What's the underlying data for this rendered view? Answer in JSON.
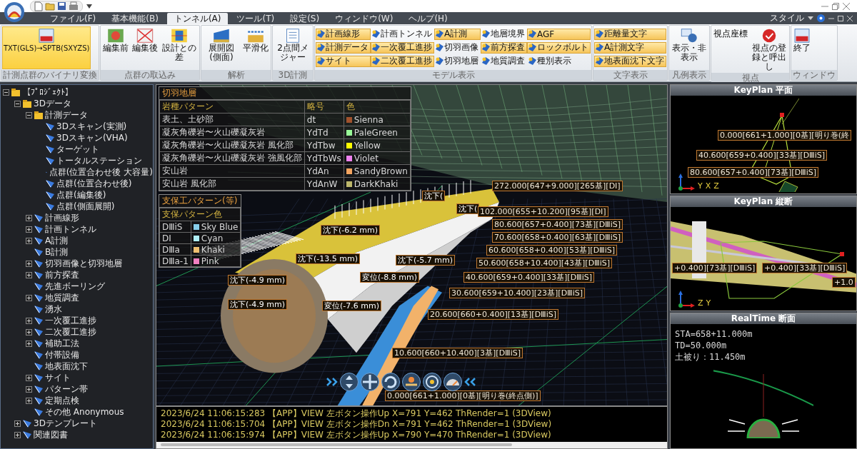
{
  "menu_tabs": [
    {
      "label": "ファイル(F)",
      "selected": false
    },
    {
      "label": "基本機能(B)",
      "selected": false
    },
    {
      "label": "トンネル(A)",
      "selected": true
    },
    {
      "label": "ツール(T)",
      "selected": false
    },
    {
      "label": "設定(S)",
      "selected": false
    },
    {
      "label": "ウィンドウ(W)",
      "selected": false
    },
    {
      "label": "ヘルプ(H)",
      "selected": false
    }
  ],
  "style_menu": "スタイル",
  "ribbon_groups": [
    {
      "label": "計測点群のバイナリ変換",
      "buttons": [
        {
          "kind": "large",
          "label": "TXT(GLS)→SPTB(SXYZS)",
          "on": true
        }
      ]
    },
    {
      "label": "点群の取込み",
      "buttons": [
        {
          "kind": "large",
          "label": "編集前",
          "on": false
        },
        {
          "kind": "large",
          "label": "編集後",
          "on": false
        },
        {
          "kind": "large",
          "label": "設計との差",
          "on": false
        }
      ]
    },
    {
      "label": "解析",
      "buttons": [
        {
          "kind": "large",
          "label": "展開図(側面)",
          "on": false
        },
        {
          "kind": "large",
          "label": "平滑化",
          "on": false
        }
      ]
    },
    {
      "label": "3D計測",
      "buttons": [
        {
          "kind": "large",
          "label": "2点間メジャー",
          "on": false
        }
      ]
    },
    {
      "label": "モデル表示",
      "buttons": [
        {
          "kind": "small",
          "label": "計画線形",
          "on": true
        },
        {
          "kind": "small",
          "label": "計測データ",
          "on": true
        },
        {
          "kind": "small",
          "label": "サイト",
          "on": true
        },
        {
          "kind": "small",
          "label": "計画トンネル",
          "on": false
        },
        {
          "kind": "small",
          "label": "一次覆工進捗",
          "on": true
        },
        {
          "kind": "small",
          "label": "二次覆工進捗",
          "on": true
        },
        {
          "kind": "small",
          "label": "A計測",
          "on": true
        },
        {
          "kind": "small",
          "label": "切羽画像",
          "on": false
        },
        {
          "kind": "small",
          "label": "切羽地層",
          "on": false
        },
        {
          "kind": "small",
          "label": "地層境界",
          "on": false
        },
        {
          "kind": "small",
          "label": "前方探査",
          "on": true
        },
        {
          "kind": "small",
          "label": "地質調査",
          "on": false
        },
        {
          "kind": "small",
          "label": "AGF",
          "on": true
        },
        {
          "kind": "small",
          "label": "ロックボルト",
          "on": true
        },
        {
          "kind": "small",
          "label": "種別表示",
          "on": false
        }
      ]
    },
    {
      "label": "文字表示",
      "buttons": [
        {
          "kind": "small",
          "label": "距離量文字",
          "on": true
        },
        {
          "kind": "small",
          "label": "A計測文字",
          "on": true
        },
        {
          "kind": "small",
          "label": "地表面沈下文字",
          "on": true
        }
      ]
    },
    {
      "label": "凡例表示",
      "buttons": [
        {
          "kind": "large",
          "label": "表示・非表示",
          "on": false
        }
      ]
    },
    {
      "label": "視点",
      "buttons": [
        {
          "kind": "text",
          "label": "視点座標"
        },
        {
          "kind": "large",
          "label": "視点の登録と呼出し",
          "on": false
        }
      ]
    },
    {
      "label": "ウィンドウ",
      "buttons": [
        {
          "kind": "large",
          "label": "終了",
          "on": false
        }
      ]
    }
  ],
  "tree": [
    {
      "label": "【ﾌﾟﾛｼﾞｪｸﾄ】",
      "expanded": true,
      "children": [
        {
          "label": "3Dデータ",
          "expanded": true,
          "children": [
            {
              "label": "計測データ",
              "expanded": true,
              "children": [
                {
                  "label": "3Dスキャン(実測)"
                },
                {
                  "label": "3Dスキャン(VHA)"
                },
                {
                  "label": "ターゲット"
                },
                {
                  "label": "トータルステーション"
                },
                {
                  "label": "点群(位置合わせ後 大容量)"
                },
                {
                  "label": "点群(位置合わせ後)"
                },
                {
                  "label": "点群(編集後)"
                },
                {
                  "label": "点群(側面展開)"
                }
              ]
            },
            {
              "label": "計画線形",
              "expanded": false
            },
            {
              "label": "計画トンネル",
              "expanded": false
            },
            {
              "label": "A計測",
              "expanded": false
            },
            {
              "label": "B計測"
            },
            {
              "label": "切羽画像と切羽地層",
              "expanded": false
            },
            {
              "label": "前方探査",
              "expanded": false
            },
            {
              "label": "先進ボーリング"
            },
            {
              "label": "地質調査",
              "expanded": false
            },
            {
              "label": "湧水"
            },
            {
              "label": "一次覆工進捗",
              "expanded": false
            },
            {
              "label": "二次覆工進捗",
              "expanded": false
            },
            {
              "label": "補助工法",
              "expanded": false
            },
            {
              "label": "付帯設備"
            },
            {
              "label": "地表面沈下"
            },
            {
              "label": "サイト",
              "expanded": false
            },
            {
              "label": "パターン帯",
              "expanded": false
            },
            {
              "label": "定期点検",
              "expanded": false
            },
            {
              "label": "その他 Anonymous"
            }
          ]
        },
        {
          "label": "3Dテンプレート",
          "expanded": false
        },
        {
          "label": "関連図書",
          "expanded": false
        }
      ]
    }
  ],
  "view3d": {
    "face_legend": {
      "title": "切羽地層",
      "columns": [
        "岩種パターン",
        "略号",
        "色"
      ],
      "rows": [
        {
          "name": "表土、土砂部",
          "code": "dt",
          "color_name": "Sienna",
          "color": "#a0522d"
        },
        {
          "name": "凝灰角礫岩〜火山礫凝灰岩",
          "code": "YdTd",
          "color_name": "PaleGreen",
          "color": "#98fb98"
        },
        {
          "name": "凝灰角礫岩〜火山礫凝灰岩 風化部",
          "code": "YdTbw",
          "color_name": "Yellow",
          "color": "#ffff00"
        },
        {
          "name": "凝灰角礫岩〜火山礫凝灰岩 強風化部",
          "code": "YdTbWs",
          "color_name": "Violet",
          "color": "#ee82ee"
        },
        {
          "name": "安山岩",
          "code": "YdAn",
          "color_name": "SandyBrown",
          "color": "#f4a460"
        },
        {
          "name": "安山岩 風化部",
          "code": "YdAnW",
          "color_name": "DarkKhaki",
          "color": "#bdb76b"
        }
      ]
    },
    "support_legend": {
      "title": "支保工パターン(等)",
      "header": "支保パターン色",
      "rows": [
        {
          "code": "DⅢiS",
          "color_name": "Sky Blue",
          "color": "#87ceeb"
        },
        {
          "code": "DⅠ",
          "color_name": "Cyan",
          "color": "#b0f0f8"
        },
        {
          "code": "DⅢa",
          "color_name": "Khaki",
          "color": "#f0c070"
        },
        {
          "code": "DⅢa-1",
          "color_name": "Pink",
          "color": "#f080c0"
        }
      ]
    },
    "labels": [
      {
        "kind": "measure",
        "text": "沈下("
      },
      {
        "kind": "measure",
        "text": "沈下("
      },
      {
        "kind": "measure",
        "text": "沈下(-6.2 mm)"
      },
      {
        "kind": "measure",
        "text": "沈下(-13.5 mm)"
      },
      {
        "kind": "measure",
        "text": "沈下(-4.9 mm)"
      },
      {
        "kind": "measure",
        "text": "変位(-8.8 mm)"
      },
      {
        "kind": "measure",
        "text": "沈下(-4.9 mm)"
      },
      {
        "kind": "measure",
        "text": "変位(-7.6 mm)"
      },
      {
        "kind": "measure",
        "text": "沈下(-5.7 mm)"
      },
      {
        "kind": "station",
        "text": "272.000[647+9.000][265基][DⅠ]"
      },
      {
        "kind": "station",
        "text": "102.000[655+10.200][95基][DⅠ]"
      },
      {
        "kind": "station",
        "text": "80.600[657+0.400][73基][DⅢiS]"
      },
      {
        "kind": "station",
        "text": "70.600[658+0.400][63基][DⅢiS]"
      },
      {
        "kind": "station",
        "text": "60.600[658+0.400][53基][DⅢiS]"
      },
      {
        "kind": "station",
        "text": "50.600[658+10.400][43基][DⅢiS]"
      },
      {
        "kind": "station",
        "text": "40.600[659+0.400][33基][DⅢiS]"
      },
      {
        "kind": "station",
        "text": "30.600[659+10.400][23基][DⅢiS]"
      },
      {
        "kind": "station",
        "text": "20.600[660+0.400][13基][DⅢiS]"
      },
      {
        "kind": "station",
        "text": "10.600[660+10.400][3基][DⅢiS]"
      },
      {
        "kind": "station",
        "text": "0.000[661+1.000][0基][明り巻(終点側)]"
      }
    ]
  },
  "log_lines": [
    "2023/6/24 11:06:15:283 【APP】VIEW 左ボタン操作Up X=791 Y=462 ThRender=1  (3DView)",
    "2023/6/24 11:06:15:704 【APP】VIEW 左ボタン操作Dn X=791 Y=462 ThRender=1  (3DView)",
    "2023/6/24 11:06:15:974 【APP】VIEW 左ボタン操作Up X=790 Y=470 ThRender=1  (3DView)"
  ],
  "side_panels": [
    {
      "title": "KeyPlan 平面",
      "labels": [
        "0.000[661+1.000][0基][明り巻(終",
        "40.600[659+0.400][33基][DⅢiS]",
        "80.600[657+0.400][73基][DⅢiS]"
      ],
      "axes": [
        "Y",
        "X",
        "Z"
      ]
    },
    {
      "title": "KeyPlan 縦断",
      "labels": [
        "+0.400][73基][DⅢiS]",
        "+0.400][33基][DⅢiS]",
        "+1.0"
      ],
      "axes": [
        "Z",
        "Y"
      ]
    },
    {
      "title": "RealTime 断面",
      "readouts": [
        "STA=658+11.000m",
        "TD=50.000m",
        "土被り：11.450m"
      ]
    }
  ]
}
